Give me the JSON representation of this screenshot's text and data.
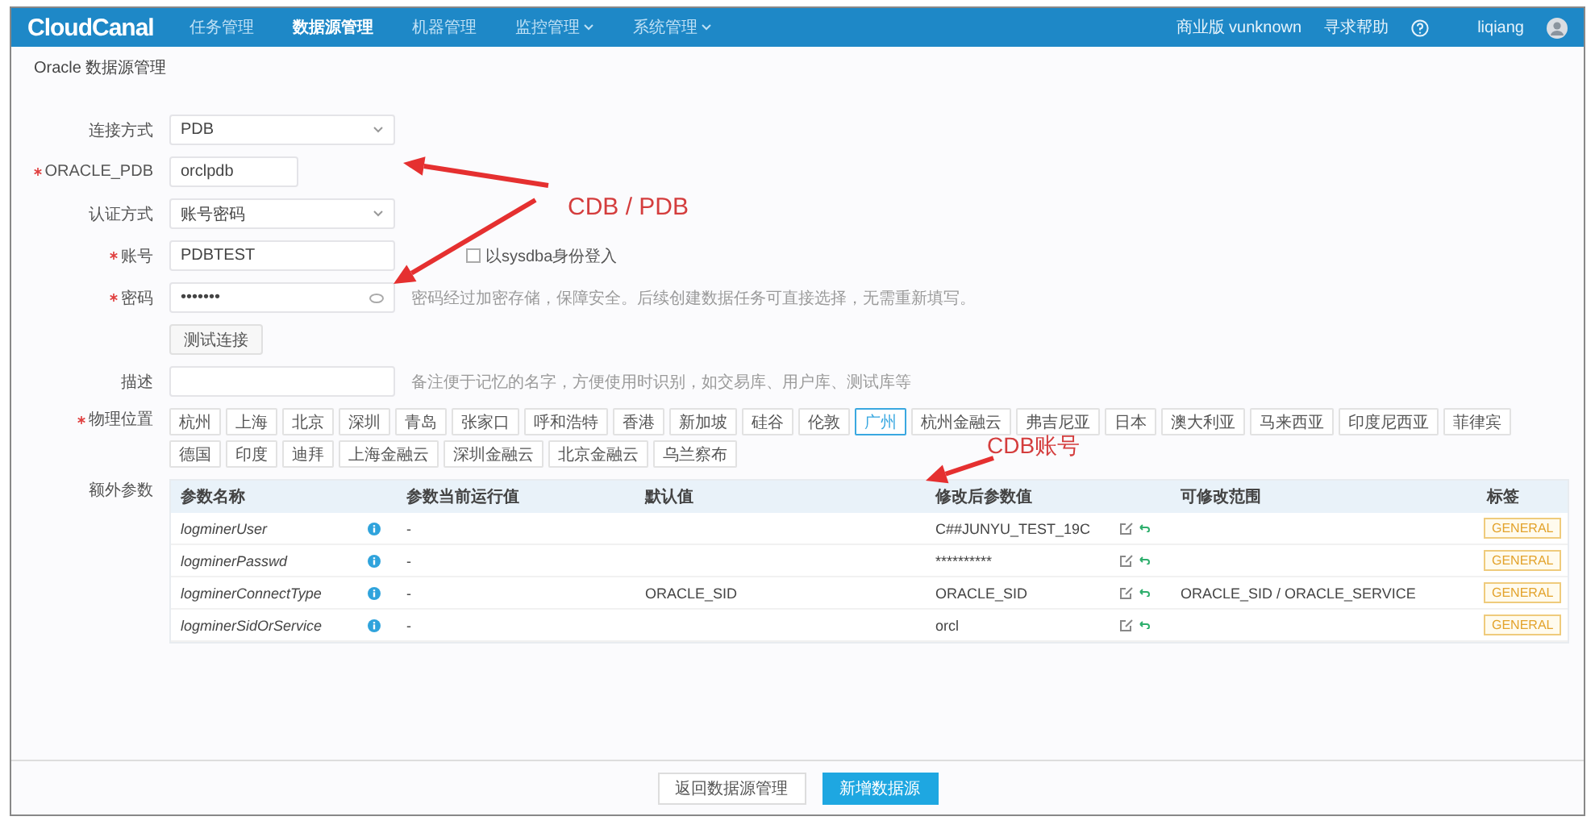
{
  "nav": {
    "logo": "CloudCanal",
    "menu": [
      {
        "label": "任务管理",
        "selected": false,
        "dropdown": false
      },
      {
        "label": "数据源管理",
        "selected": true,
        "dropdown": false
      },
      {
        "label": "机器管理",
        "selected": false,
        "dropdown": false
      },
      {
        "label": "监控管理",
        "selected": false,
        "dropdown": true
      },
      {
        "label": "系统管理",
        "selected": false,
        "dropdown": true
      }
    ],
    "edition": "商业版 vunknown",
    "help": "寻求帮助",
    "user": "liqiang"
  },
  "breadcrumb": "Oracle 数据源管理",
  "form": {
    "fields": [
      {
        "kind": "select",
        "label": "连接方式",
        "required": false,
        "value": "PDB"
      },
      {
        "kind": "input",
        "label": "ORACLE_PDB",
        "required": true,
        "value": "orclpdb"
      },
      {
        "kind": "select",
        "label": "认证方式",
        "required": false,
        "value": "账号密码"
      },
      {
        "kind": "input",
        "label": "账号",
        "required": true,
        "value": "PDBTEST",
        "checkbox": {
          "label": "以sysdba身份登入",
          "checked": false
        }
      },
      {
        "kind": "password",
        "label": "密码",
        "required": true,
        "value": "•••••••",
        "hint": "密码经过加密存储，保障安全。后续创建数据任务可直接选择，无需重新填写。"
      },
      {
        "kind": "button",
        "label": "测试连接"
      },
      {
        "kind": "input",
        "label": "描述",
        "required": false,
        "hint": "备注便于记忆的名字，方便使用时识别，如交易库、用户库、测试库等"
      }
    ],
    "region": {
      "label": "物理位置",
      "required": true,
      "options": [
        {
          "label": "杭州",
          "selected": false
        },
        {
          "label": "上海",
          "selected": false
        },
        {
          "label": "北京",
          "selected": false
        },
        {
          "label": "深圳",
          "selected": false
        },
        {
          "label": "青岛",
          "selected": false
        },
        {
          "label": "张家口",
          "selected": false
        },
        {
          "label": "呼和浩特",
          "selected": false
        },
        {
          "label": "香港",
          "selected": false
        },
        {
          "label": "新加坡",
          "selected": false
        },
        {
          "label": "硅谷",
          "selected": false
        },
        {
          "label": "伦敦",
          "selected": false
        },
        {
          "label": "广州",
          "selected": true
        },
        {
          "label": "杭州金融云",
          "selected": false
        },
        {
          "label": "弗吉尼亚",
          "selected": false
        },
        {
          "label": "日本",
          "selected": false
        },
        {
          "label": "澳大利亚",
          "selected": false
        },
        {
          "label": "马来西亚",
          "selected": false
        },
        {
          "label": "印度尼西亚",
          "selected": false
        },
        {
          "label": "菲律宾",
          "selected": false
        },
        {
          "label": "德国",
          "selected": false
        },
        {
          "label": "印度",
          "selected": false
        },
        {
          "label": "迪拜",
          "selected": false
        },
        {
          "label": "上海金融云",
          "selected": false
        },
        {
          "label": "深圳金融云",
          "selected": false
        },
        {
          "label": "北京金融云",
          "selected": false
        },
        {
          "label": "乌兰察布",
          "selected": false
        }
      ]
    }
  },
  "params": {
    "label": "额外参数",
    "columns": [
      "参数名称",
      "参数当前运行值",
      "默认值",
      "修改后参数值",
      "可修改范围",
      "标签"
    ],
    "rows": [
      {
        "name": "logminerUser",
        "current": "-",
        "default": "",
        "value": "C##JUNYU_TEST_19C",
        "range": "",
        "tag": "GENERAL"
      },
      {
        "name": "logminerPasswd",
        "current": "-",
        "default": "",
        "value": "**********",
        "range": "",
        "tag": "GENERAL"
      },
      {
        "name": "logminerConnectType",
        "current": "-",
        "default": "ORACLE_SID",
        "value": "ORACLE_SID",
        "range": "ORACLE_SID / ORACLE_SERVICE",
        "tag": "GENERAL"
      },
      {
        "name": "logminerSidOrService",
        "current": "-",
        "default": "",
        "value": "orcl",
        "range": "",
        "tag": "GENERAL"
      }
    ]
  },
  "footer": {
    "buttons": [
      {
        "label": "返回数据源管理",
        "primary": false
      },
      {
        "label": "新增数据源",
        "primary": true
      }
    ]
  },
  "annotations": [
    {
      "label": "CDB / PDB"
    },
    {
      "label": "CDB账号"
    }
  ]
}
